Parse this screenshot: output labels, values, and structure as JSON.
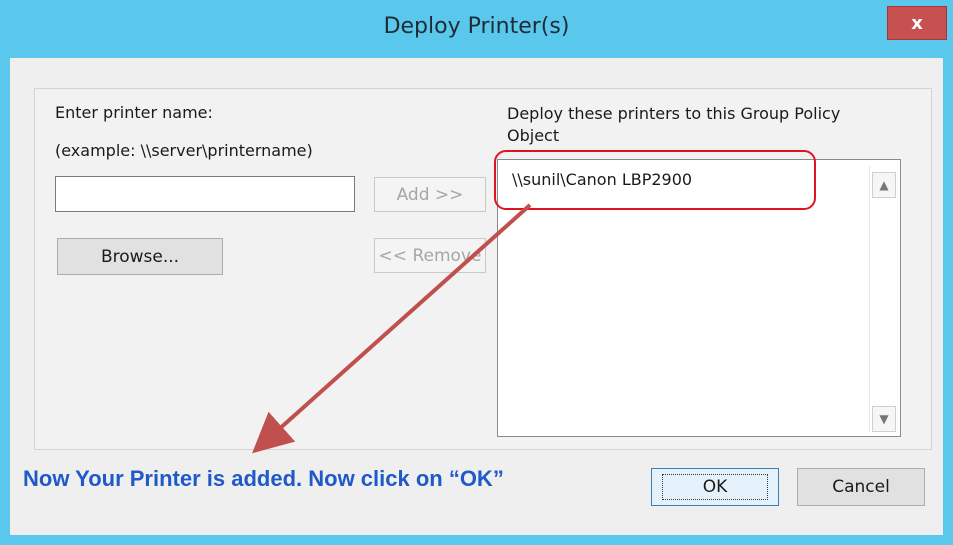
{
  "window": {
    "title": "Deploy Printer(s)",
    "close_glyph": "x"
  },
  "form": {
    "enter_label": "Enter printer name:",
    "example_label": "(example: \\\\server\\printername)",
    "printer_name_value": "",
    "add_label": "Add >>",
    "remove_label": "<< Remove",
    "browse_label": "Browse...",
    "deploy_label": "Deploy these printers to this Group Policy Object",
    "deployed_printers": [
      "\\\\sunil\\Canon LBP2900"
    ]
  },
  "annotation": {
    "text": "Now Your Printer is added. Now click on “OK”",
    "color": "#1f5ac8",
    "arrow_color": "#c0504d",
    "box_color": "#e0141e"
  },
  "footer": {
    "ok_label": "OK",
    "cancel_label": "Cancel"
  },
  "colors": {
    "titlebar": "#5ac8ec",
    "close": "#c75050"
  }
}
